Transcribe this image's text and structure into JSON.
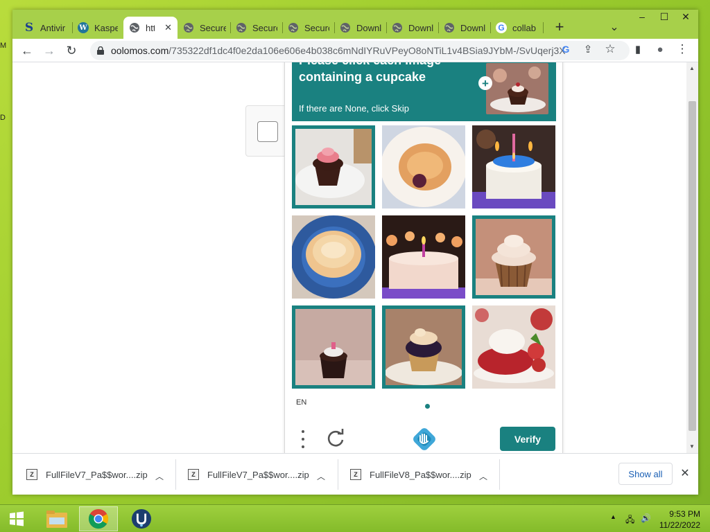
{
  "desktop": {
    "labels": [
      "M",
      "D"
    ]
  },
  "browser": {
    "tabs": [
      {
        "label": "Antivir",
        "icon": "s-logo-icon",
        "color": "#1b3f8f",
        "active": false
      },
      {
        "label": "Kasper",
        "icon": "wordpress-icon",
        "color": "#21759b",
        "active": false
      },
      {
        "label": "htt",
        "icon": "globe-icon",
        "color": "#5f6368",
        "active": true
      },
      {
        "label": "Secure",
        "icon": "globe-icon",
        "color": "#5f6368",
        "active": false
      },
      {
        "label": "Secure",
        "icon": "globe-icon",
        "color": "#5f6368",
        "active": false
      },
      {
        "label": "Secure",
        "icon": "globe-icon",
        "color": "#5f6368",
        "active": false
      },
      {
        "label": "Downl",
        "icon": "globe-icon",
        "color": "#5f6368",
        "active": false
      },
      {
        "label": "Downl",
        "icon": "globe-icon",
        "color": "#5f6368",
        "active": false
      },
      {
        "label": "Downl",
        "icon": "globe-icon",
        "color": "#5f6368",
        "active": false
      },
      {
        "label": "collab",
        "icon": "google-icon",
        "color": "#4285f4",
        "active": false
      }
    ],
    "new_tab": "+",
    "tab_search": "⌄",
    "window_controls": {
      "minimize": "–",
      "maximize": "☐",
      "close": "✕"
    },
    "url_host": "oolomos.com",
    "url_path": "/735322df1dc4f0e2da106e606e4b038c6mNdIYRuVPeyO8oNTiL1v4BSia9JYbM-/SvUqerj3X",
    "nav": {
      "back": "←",
      "forward": "→",
      "reload": "↻"
    },
    "omnibox_icons": {
      "google": "G",
      "share": "⇪",
      "bookmark": "☆"
    },
    "toolbar_icons": {
      "side_panel": "▮",
      "profile": "●",
      "menu": "⋮"
    }
  },
  "captcha": {
    "prompt_title": "Please click each image containing a cupcake",
    "prompt_sub": "If there are None, click Skip",
    "example_plus": "+",
    "tiles": [
      {
        "name": "tile-cupcake-plate",
        "selected": true
      },
      {
        "name": "tile-pastry-plate",
        "selected": false
      },
      {
        "name": "tile-birthday-cake-blue",
        "selected": false
      },
      {
        "name": "tile-pancake-plate",
        "selected": false
      },
      {
        "name": "tile-birthday-cake-candle",
        "selected": false
      },
      {
        "name": "tile-cupcake-frosted",
        "selected": true
      },
      {
        "name": "tile-cupcake-small",
        "selected": true
      },
      {
        "name": "tile-cupcake-chocolate",
        "selected": true
      },
      {
        "name": "tile-strawberry-dessert",
        "selected": false
      }
    ],
    "language": "EN",
    "verify_label": "Verify",
    "accent": "#1a8180"
  },
  "downloads": {
    "items": [
      {
        "name": "FullFileV7_Pa$$wor....zip"
      },
      {
        "name": "FullFileV7_Pa$$wor....zip"
      },
      {
        "name": "FullFileV8_Pa$$wor....zip"
      }
    ],
    "show_all": "Show all",
    "close": "✕",
    "chevron": "︿"
  },
  "taskbar": {
    "apps": [
      {
        "name": "file-explorer-icon",
        "active": false
      },
      {
        "name": "chrome-icon",
        "active": true
      },
      {
        "name": "app-icon",
        "active": false
      }
    ],
    "time": "9:53 PM",
    "date": "11/22/2022"
  }
}
